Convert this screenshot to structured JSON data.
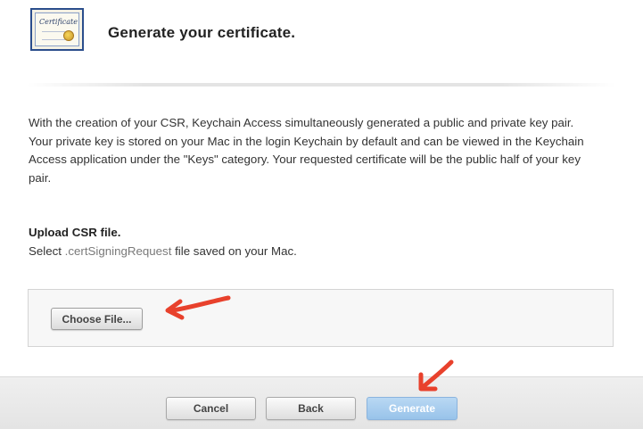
{
  "header": {
    "title": "Generate your certificate.",
    "icon_word": "Certificate"
  },
  "description": "With the creation of your CSR, Keychain Access simultaneously generated a public and private key pair. Your private key is stored on your Mac in the login Keychain by default and can be viewed in the Keychain Access application under the \"Keys\" category. Your requested certificate will be the public half of your key pair.",
  "upload": {
    "heading": "Upload CSR file.",
    "instruction_prefix": "Select ",
    "instruction_code": ".certSigningRequest",
    "instruction_suffix": " file saved on your Mac.",
    "choose_file_label": "Choose File..."
  },
  "footer": {
    "cancel_label": "Cancel",
    "back_label": "Back",
    "generate_label": "Generate"
  },
  "colors": {
    "annotation_arrow": "#e8412c",
    "generate_button": "#a9cdee"
  }
}
